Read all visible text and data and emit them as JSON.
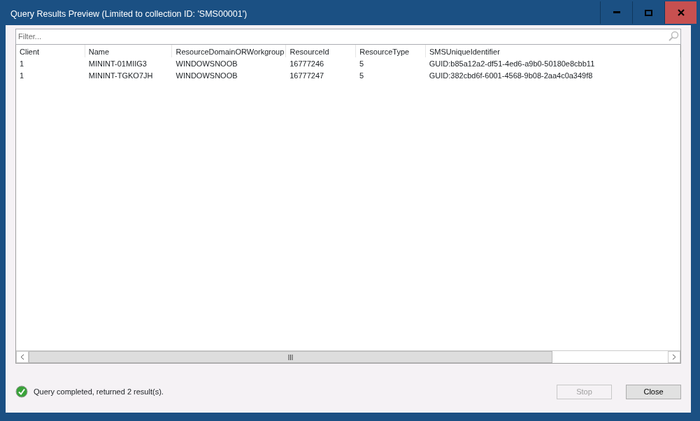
{
  "window": {
    "title": "Query Results Preview (Limited to collection ID: 'SMS00001')"
  },
  "filter": {
    "placeholder": "Filter..."
  },
  "table": {
    "columns": [
      "Client",
      "Name",
      "ResourceDomainORWorkgroup",
      "ResourceId",
      "ResourceType",
      "SMSUniqueIdentifier"
    ],
    "rows": [
      [
        "1",
        "MININT-01MIIG3",
        "WINDOWSNOOB",
        "16777246",
        "5",
        "GUID:b85a12a2-df51-4ed6-a9b0-50180e8cbb11"
      ],
      [
        "1",
        "MININT-TGKO7JH",
        "WINDOWSNOOB",
        "16777247",
        "5",
        "GUID:382cbd6f-6001-4568-9b08-2aa4c0a349f8"
      ]
    ]
  },
  "status_bar": {
    "text": "Query completed, returned 2 result(s)."
  },
  "buttons": [
    {
      "label": "Stop",
      "disabled": true
    },
    {
      "label": "Close",
      "disabled": false
    }
  ]
}
